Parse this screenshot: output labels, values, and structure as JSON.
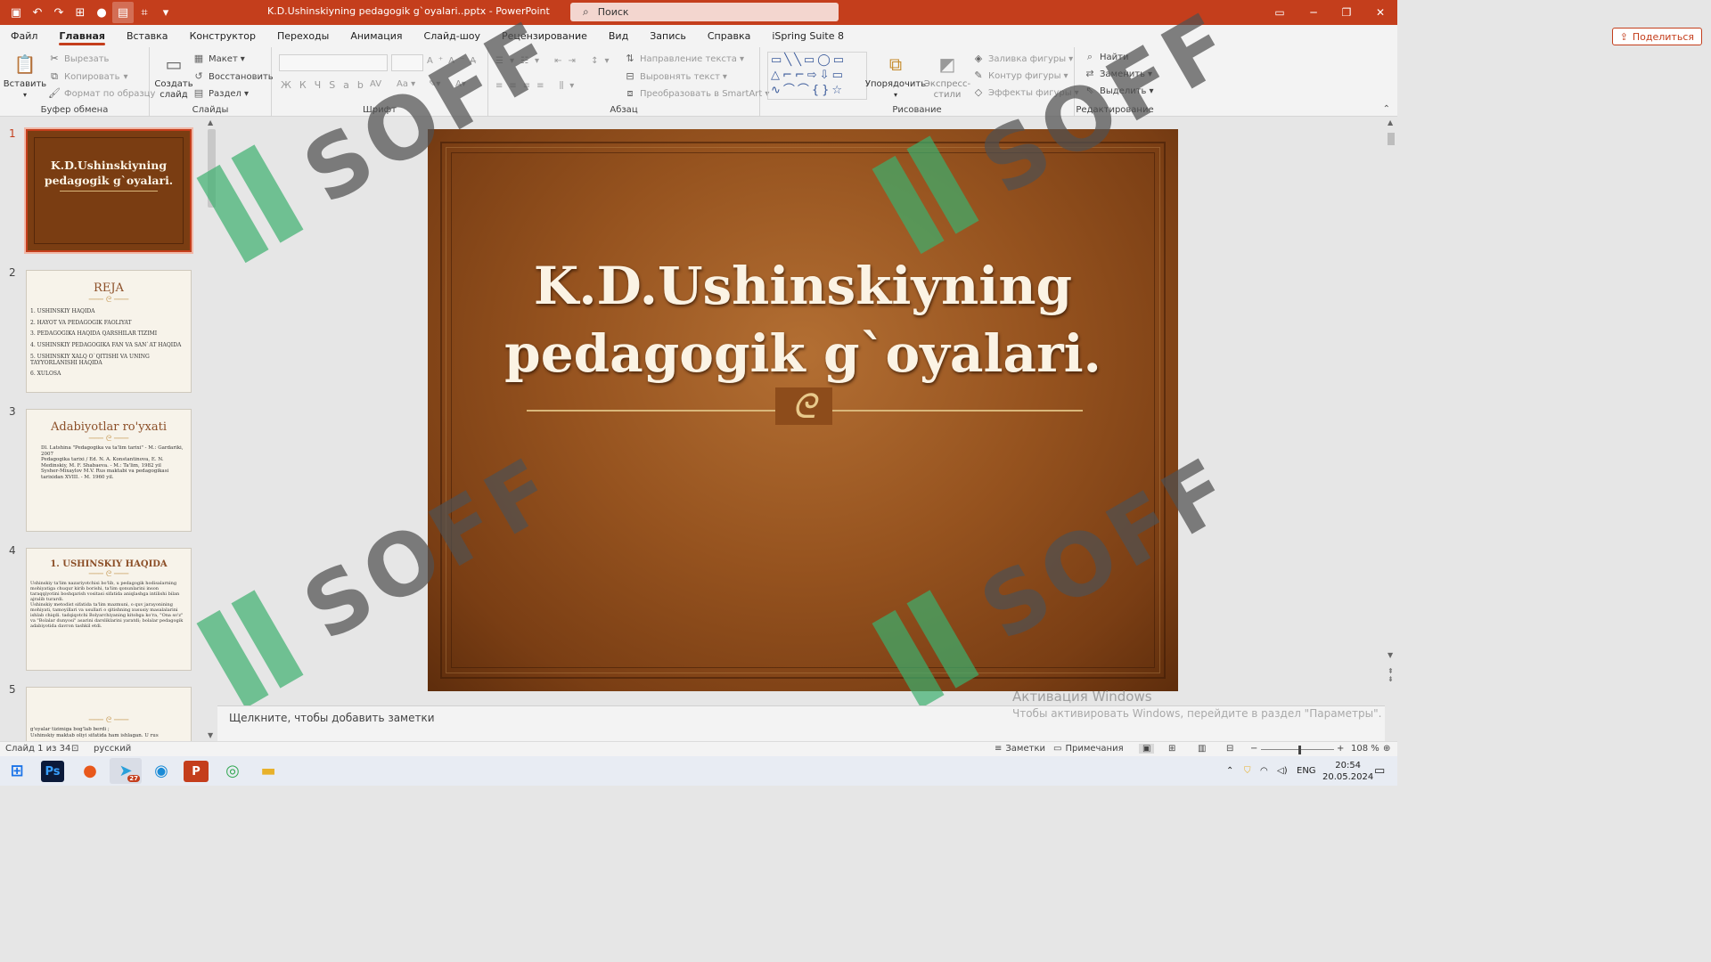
{
  "window": {
    "title": "K.D.Ushinskiyning pedagogik g`oyalari..pptx  -  PowerPoint",
    "search_placeholder": "Поиск",
    "share_label": "Поделиться"
  },
  "menu": [
    "Файл",
    "Главная",
    "Вставка",
    "Конструктор",
    "Переходы",
    "Анимация",
    "Слайд-шоу",
    "Рецензирование",
    "Вид",
    "Запись",
    "Справка",
    "iSpring Suite 8"
  ],
  "ribbon": {
    "clipboard": {
      "label": "Буфер обмена",
      "paste": "Вставить",
      "cut": "Вырезать",
      "copy": "Копировать",
      "format": "Формат по образцу"
    },
    "slides": {
      "label": "Слайды",
      "new_slide": "Создать слайд",
      "layout": "Макет",
      "reset": "Восстановить",
      "section": "Раздел"
    },
    "font": {
      "label": "Шрифт"
    },
    "paragraph": {
      "label": "Абзац",
      "text_direction": "Направление текста",
      "align_text": "Выровнять текст",
      "smartart": "Преобразовать в SmartArt"
    },
    "drawing": {
      "label": "Рисование",
      "arrange": "Упорядочить",
      "quick_styles": "Экспресс-стили",
      "fill": "Заливка фигуры",
      "outline": "Контур фигуры",
      "effects": "Эффекты фигуры"
    },
    "editing": {
      "label": "Редактирование",
      "find": "Найти",
      "replace": "Заменить",
      "select": "Выделить"
    }
  },
  "thumbnails": [
    {
      "num": "1",
      "title": "K.D.Ushinskiyning pedagogik g`oyalari."
    },
    {
      "num": "2",
      "title": "REJA",
      "lines": [
        "1. USHINSKIY HAQIDA",
        "2. HAYOT VA PEDAGOGIK FAOLIYAT",
        "3. PEDAGOGIKA HAQIDA QARSHILAR TIZIMI",
        "4. USHINSKIY PEDAGOGIKA FAN VA SAN`AT HAQIDA",
        "5. USHINSKIY XALQ O`QITISHI VA UNING TAYYORLANISHI HAQIDA",
        "6. XULOSA"
      ]
    },
    {
      "num": "3",
      "title": "Adabiyotlar ro'yxati",
      "lines": [
        "Dl. Latshina \"Pedagogika va ta'lim tarixi\" - M.: Gardariki, 2007",
        "Pedagogika tarixi / Ed. N. A. Konstantinova, E. N. Medinskiy, M. F. Shabaeva. - M.: Ta'lim, 1982 yil",
        "Sysher-Mixaylov M.V. Rus maktabi va pedagogikasi tarixidan XVIII. - M. 1960 yil."
      ]
    },
    {
      "num": "4",
      "title": "1. USHINSKIY HAQIDA",
      "lines": [
        "Ushinskiy ta'lim nazariyotchisi bo'lib, u pedagogik hodisalarning mohiyatiga chuqur kirib borishi, ta'lim qonunlarini inson taraqqiyotini boshqarish vositasi sifatida aniqlashga intilishi bilan ajralib turardi.",
        "Ushinskiy metodist sifatida ta'lim mazmuni, o quv jarayonining mohiyati, tamoyillari va usullari o qitishning xususiy masalalarini ishlab chiqdi. tadqiqotchi Bolyarchiyaning kitobga ko'ra, \"Ona so'z\" va \"Bolalar dunyosi\" asarini darsliklarini yaratdi; bolalar pedagogik adabiyotida davron tashkil etdi."
      ]
    },
    {
      "num": "5",
      "title": "",
      "lines": [
        "g'oyalar tizimiga bog'lab berdi ;",
        "Ushinskiy maktab oliyi sifatida ham ishlagan. U rus"
      ]
    }
  ],
  "slide": {
    "title_line1": "K.D.Ushinskiyning",
    "title_line2": "pedagogik g`oyalari.",
    "ornament": "ᘓ"
  },
  "notes_placeholder": "Щелкните, чтобы добавить заметки",
  "activation": {
    "title": "Активация Windows",
    "text": "Чтобы активировать Windows, перейдите в раздел \"Параметры\"."
  },
  "status": {
    "slide_counter": "Слайд 1 из 34",
    "language": "русский",
    "notes": "Заметки",
    "comments": "Примечания",
    "zoom": "108 %"
  },
  "tray": {
    "lang": "ENG",
    "time": "20:54",
    "date": "20.05.2024",
    "telegram_badge": "27"
  },
  "watermark": "SOFF",
  "colors": {
    "accent": "#c43e1c",
    "slide_brown": "#96531f",
    "cream": "#fbf3e4"
  }
}
